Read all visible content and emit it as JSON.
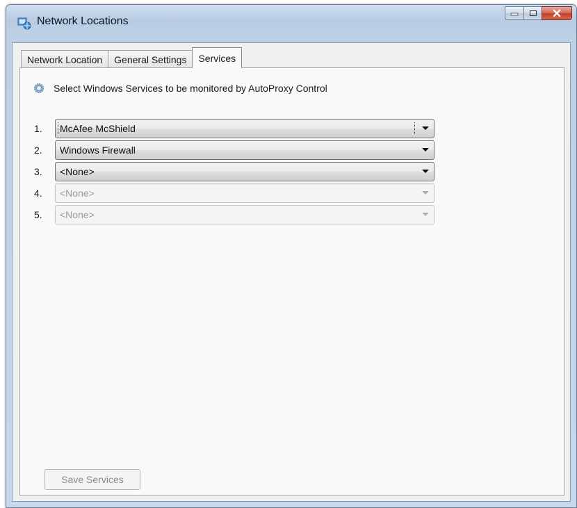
{
  "window": {
    "title": "Network Locations",
    "icon": "network-location-icon"
  },
  "tabs": [
    {
      "label": "Network Location",
      "active": false
    },
    {
      "label": "General Settings",
      "active": false
    },
    {
      "label": "Services",
      "active": true
    }
  ],
  "services_panel": {
    "header_icon": "gear-icon",
    "header_text": "Select Windows Services to be monitored by AutoProxy Control",
    "rows": [
      {
        "number": "1.",
        "value": "McAfee McShield",
        "enabled": true,
        "focused": true
      },
      {
        "number": "2.",
        "value": "Windows Firewall",
        "enabled": true,
        "focused": false
      },
      {
        "number": "3.",
        "value": "<None>",
        "enabled": true,
        "focused": false
      },
      {
        "number": "4.",
        "value": "<None>",
        "enabled": false,
        "focused": false
      },
      {
        "number": "5.",
        "value": "<None>",
        "enabled": false,
        "focused": false
      }
    ],
    "save_label": "Save Services",
    "save_enabled": false
  }
}
